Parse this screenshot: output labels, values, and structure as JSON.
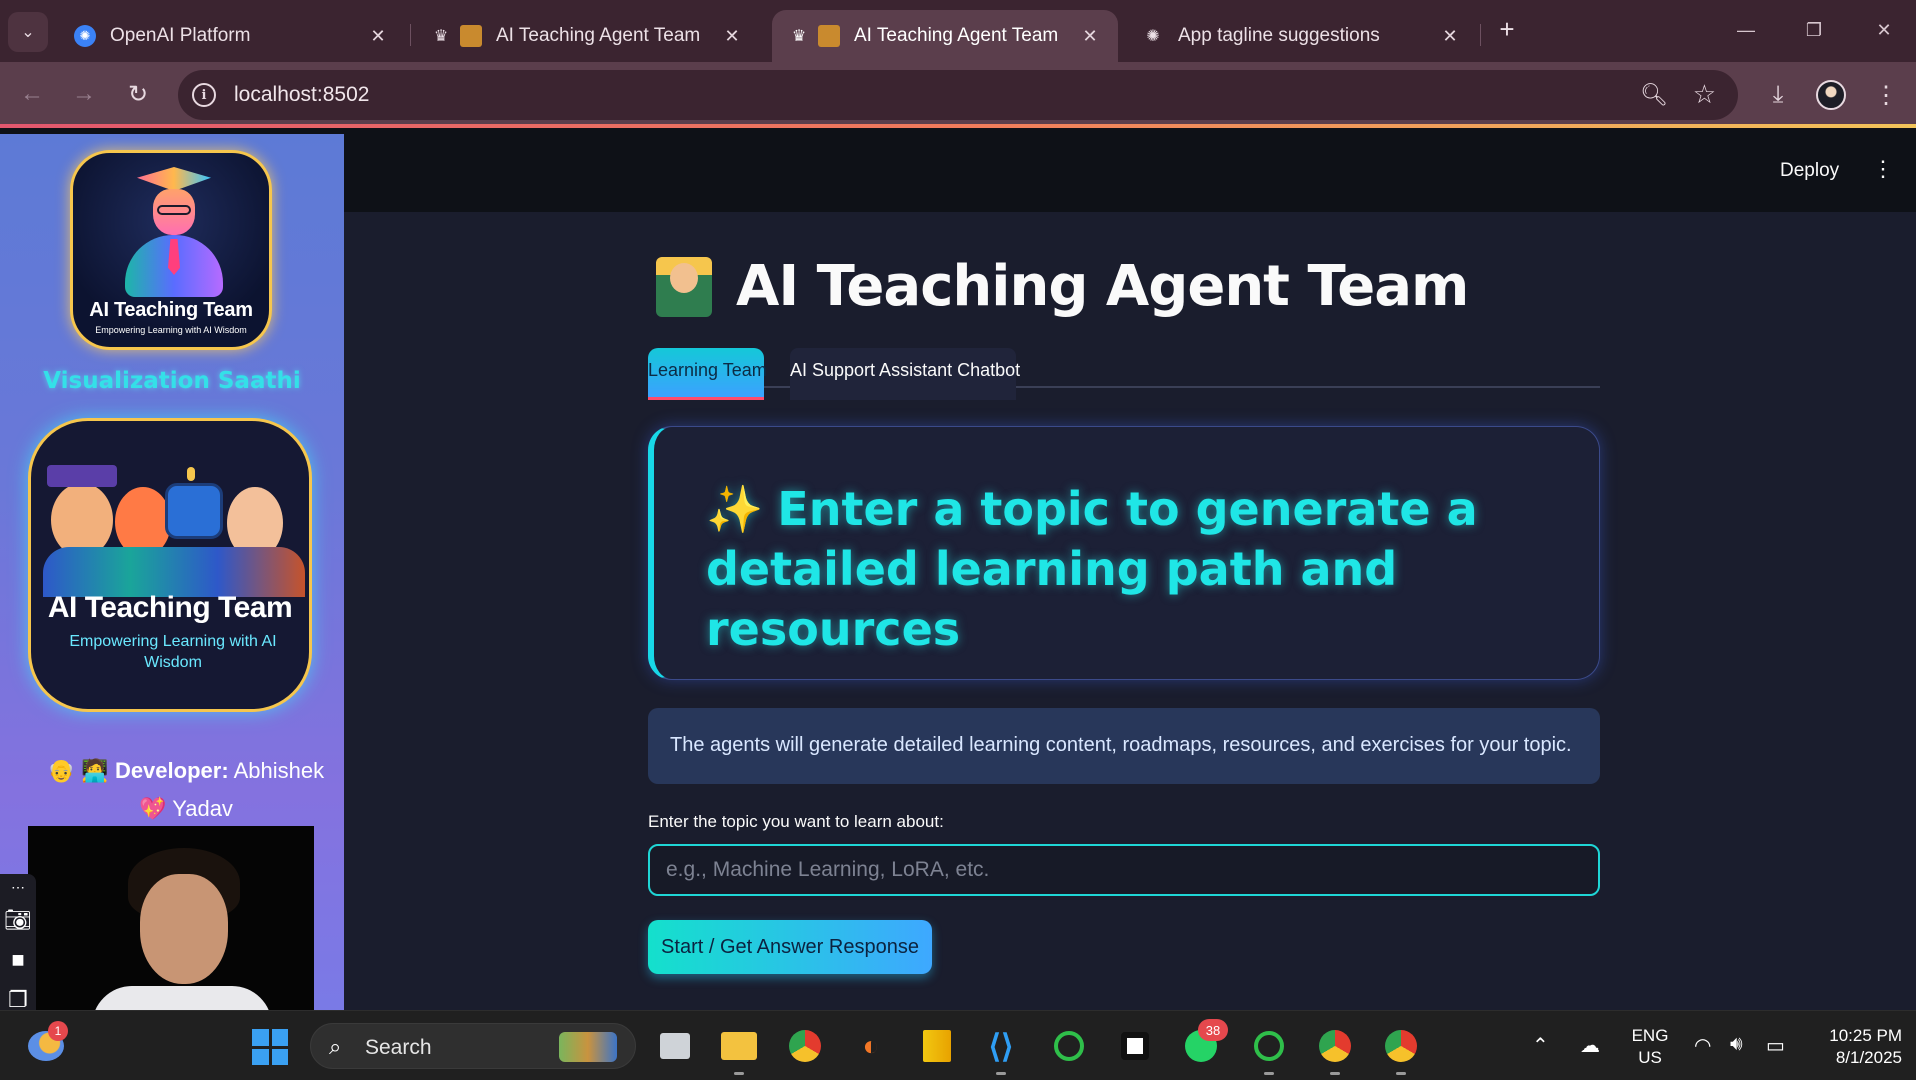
{
  "browser": {
    "tabs": [
      {
        "title": "OpenAI Platform",
        "active": false
      },
      {
        "title": "AI Teaching Agent Team",
        "active": false
      },
      {
        "title": "AI Teaching Agent Team",
        "active": true
      },
      {
        "title": "App tagline suggestions",
        "active": false
      }
    ],
    "url": "localhost:8502"
  },
  "sidebar": {
    "logo": {
      "title": "AI Teaching Team",
      "subtitle": "Empowering Learning with AI Wisdom"
    },
    "app_name": "Visualization Saathi",
    "team_card": {
      "title": "AI Teaching Team",
      "subtitle": "Empowering Learning with AI Wisdom"
    },
    "developer_label": "Developer:",
    "developer_name": "Abhishek",
    "developer_surname": "Yadav"
  },
  "header": {
    "deploy_label": "Deploy"
  },
  "main": {
    "title": "AI Teaching Agent Team",
    "tabs": [
      {
        "label": "Learning Team",
        "active": true
      },
      {
        "label": "AI Support Assistant Chatbot",
        "active": false
      }
    ],
    "hero_text": "Enter a topic to generate a detailed learning path and resources",
    "info_text": "The agents will generate detailed learning content, roadmaps, resources, and exercises for your topic.",
    "topic_label": "Enter the topic you want to learn about:",
    "topic_placeholder": "e.g., Machine Learning, LoRA, etc.",
    "topic_value": "",
    "start_button": "Start / Get Answer Response"
  },
  "taskbar": {
    "weather_badge": "1",
    "search_label": "Search",
    "whatsapp_badge": "38",
    "lang_line1": "ENG",
    "lang_line2": "US",
    "time": "10:25 PM",
    "date": "8/1/2025"
  },
  "colors": {
    "accent_cyan": "#1fe6e6",
    "sidebar_gradient_start": "#5d7ad6",
    "sidebar_gradient_end": "#7a7ae6",
    "active_tab_underline": "#ff4b6b"
  }
}
